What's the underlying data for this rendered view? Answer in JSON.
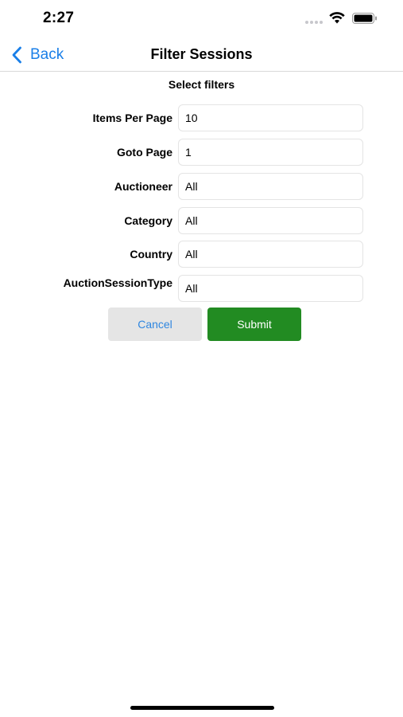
{
  "status_bar": {
    "time": "2:27",
    "icons": [
      "signal-icon",
      "wifi-icon",
      "battery-icon"
    ]
  },
  "nav": {
    "back_label": "Back",
    "title": "Filter Sessions"
  },
  "form": {
    "section_title": "Select filters",
    "fields": [
      {
        "label": "Items Per Page",
        "value": "10"
      },
      {
        "label": "Goto Page",
        "value": "1"
      },
      {
        "label": "Auctioneer",
        "value": "All"
      },
      {
        "label": "Category",
        "value": "All"
      },
      {
        "label": "Country",
        "value": "All"
      },
      {
        "label": "AuctionSessionType",
        "value": "All"
      }
    ]
  },
  "actions": {
    "cancel_label": "Cancel",
    "submit_label": "Submit"
  },
  "colors": {
    "accent": "#1a7fe8",
    "submit_bg": "#228b22",
    "cancel_bg": "#e5e5e5"
  }
}
